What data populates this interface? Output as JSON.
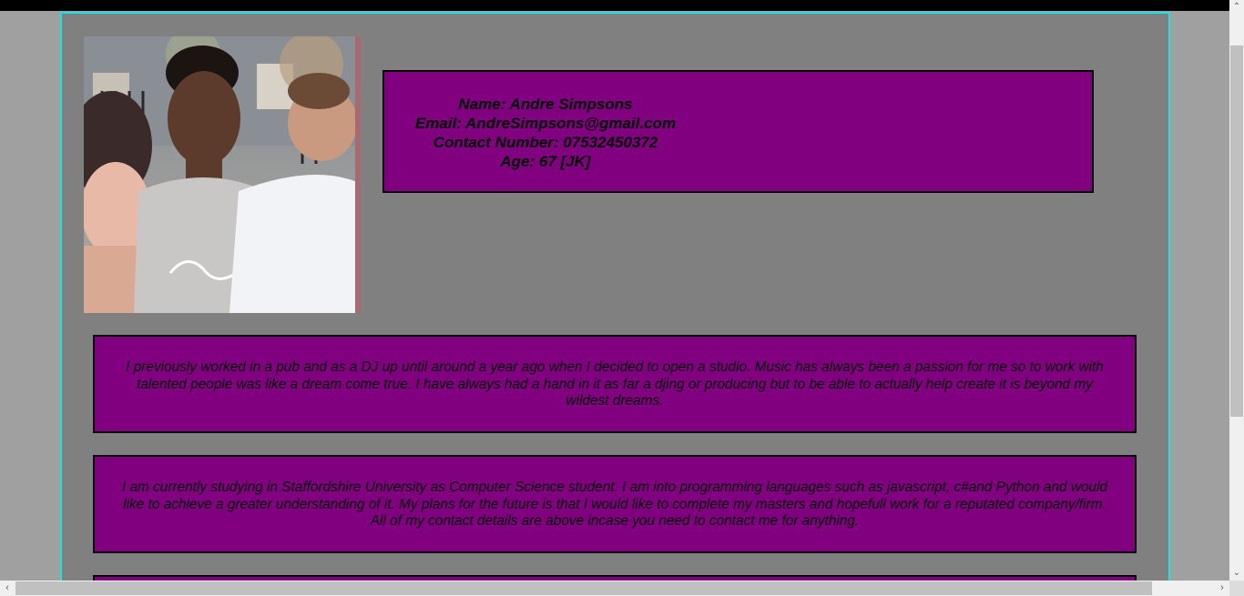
{
  "profile": {
    "name_line": "Name: Andre Simpsons",
    "email_line": "Email: AndreSimpsons@gmail.com",
    "contact_line": "Contact Number: 07532450372",
    "age_line": "Age: 67 [JK]"
  },
  "paragraphs": [
    "I previously worked in a pub and as a DJ up until around a year ago when I decided to open a studio. Music has always been a passion for me so to work with talented people was like a dream come true. I have always had a hand in it as far a djing or producing but to be able to actually help create it is beyond my wildest dreams.",
    "I am currently studying in Staffordshire University as Computer Science student. I am into programming languages such as javascript, c#and Python and would like to achieve a greater understanding of it. My plans for the future is that I would like to complete my masters and hopefull work for a reputated company/firm. All of my contact details are above incase you need to contact me for anything."
  ],
  "colors": {
    "page_background": "#a0a0a0",
    "content_background": "#808080",
    "frame_border": "#19e3e3",
    "box_background": "#800080",
    "box_border": "#000000"
  },
  "icons": {
    "scroll_up": "chevron-up-icon",
    "scroll_down": "chevron-down-icon",
    "scroll_left": "chevron-left-icon",
    "scroll_right": "chevron-right-icon"
  }
}
